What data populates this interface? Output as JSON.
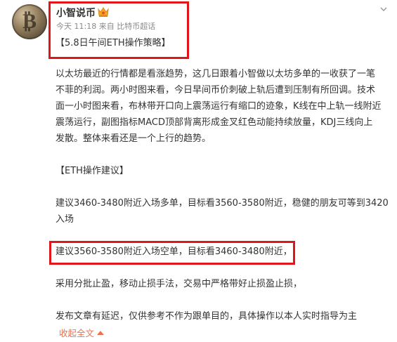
{
  "post": {
    "username": "小智说币",
    "meta": "今天 11:18 来自 比特币超话",
    "title": "【5.8日午间ETH操作策略】",
    "paragraph1": [
      "以太坊最近的行情都是看涨趋势，这几日跟着小智做以太坊多单的一收获了一笔",
      "不菲的利润。两小时图来看，今日早间币价刺破上轨后遭到压制有所回调。技术",
      "面一小时图来看，布林带开口向上震荡运行有缩口的迹象，K线在中上轨一线附近",
      "震荡运行，副图指标MACD顶部背离形成金叉红色动能持续放量，KDJ三线向上",
      "发散。整体来看还是一个上行的趋势。"
    ],
    "section_heading": "【ETH操作建议】",
    "suggestion1": [
      "建议3460-3480附近入场多单，目标看3560-3580附近，稳健的朋友可等到3420",
      "入场"
    ],
    "suggestion2": "建议3560-3580附近入场空单，目标看3460-3480附近，",
    "risk_note": "采用分批止盈，移动止损手法，交易中严格带好止损盈止损，",
    "disclaimer": "发布文章有延迟，仅供参考不作为跟单目的，具体操作以本人实时指导为主",
    "collapse_label": "收起全文"
  },
  "icons": {
    "avatar": "bitcoin-coin-avatar",
    "badge": "crown-badge-icon",
    "menu": "chevron-down-icon"
  },
  "colors": {
    "highlight_box": "#e0161b",
    "link": "#eb7350",
    "meta_text": "#8a8a8a"
  }
}
